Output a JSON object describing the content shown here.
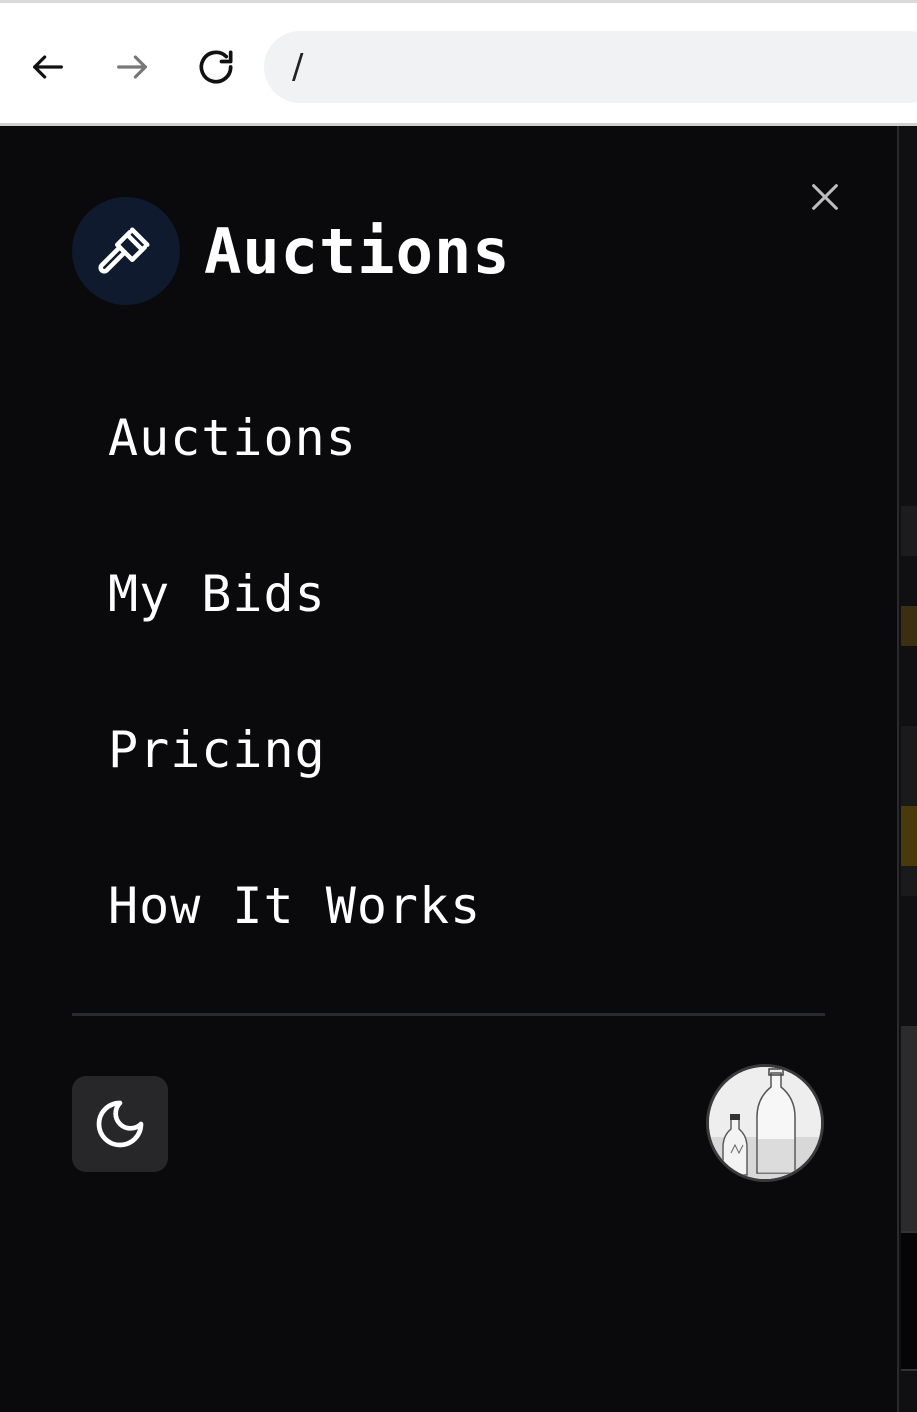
{
  "browser": {
    "url": "/",
    "back_icon": "arrow-left-icon",
    "forward_icon": "arrow-right-icon",
    "reload_icon": "reload-icon"
  },
  "drawer": {
    "brand_title": "Auctions",
    "brand_icon": "gavel-icon",
    "close_icon": "close-icon",
    "menu": [
      {
        "label": "Auctions"
      },
      {
        "label": "My Bids"
      },
      {
        "label": "Pricing"
      },
      {
        "label": "How It Works"
      }
    ],
    "theme_icon": "moon-icon",
    "avatar_icon": "user-avatar"
  },
  "colors": {
    "background": "#0a0a0c",
    "brand_circle": "#0f1a2e",
    "toggle_bg": "#27272a",
    "divider": "#2a2b2e"
  }
}
